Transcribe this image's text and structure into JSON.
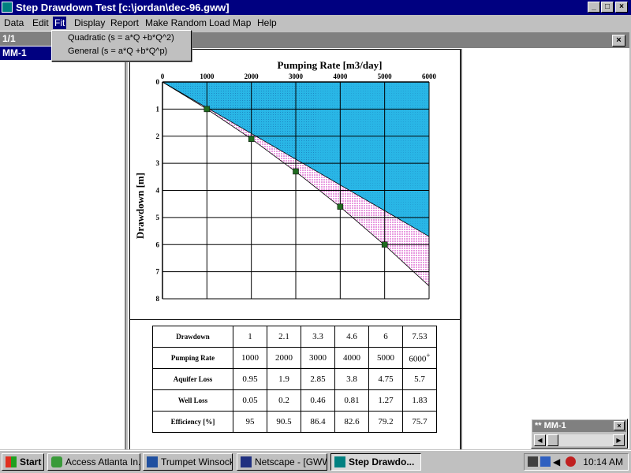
{
  "window": {
    "title": "Step Drawdown Test [c:\\jordan\\dec-96.gww]",
    "buttons": {
      "minimize": "_",
      "maximize": "□",
      "close": "×"
    }
  },
  "menu": {
    "items": [
      "Data",
      "Edit",
      "Fit",
      "Display",
      "Report",
      "Make Random",
      "Load Map",
      "Help"
    ],
    "active": "Fit"
  },
  "fit_dropdown": {
    "items": [
      "Quadratic  (s = a*Q +b*Q^2)",
      "General  (s = a*Q +b*Q^p)"
    ]
  },
  "left_panel": {
    "header": "1/1",
    "selected_item": "MM-1"
  },
  "chart_data": {
    "type": "line",
    "title": "Pumping Rate [m3/day]",
    "xlabel": "Pumping Rate [m3/day]",
    "ylabel": "Drawdown [m]",
    "x_axis_position": "top",
    "y_inverted": true,
    "xlim": [
      0,
      6000
    ],
    "ylim": [
      0,
      8
    ],
    "x_ticks": [
      "0",
      "1000",
      "2000",
      "3000",
      "4000",
      "5000",
      "6000"
    ],
    "y_ticks": [
      "0",
      "1",
      "2",
      "3",
      "4",
      "5",
      "6",
      "7",
      "8"
    ],
    "grid": true,
    "observed_points": {
      "x": [
        1000,
        2000,
        3000,
        4000,
        5000
      ],
      "y": [
        1,
        2.1,
        3.3,
        4.6,
        6
      ]
    },
    "aquifer_loss_line": {
      "x": [
        0,
        6000
      ],
      "y": [
        0,
        5.7
      ]
    },
    "total_drawdown_curve": {
      "x": [
        0,
        1000,
        2000,
        3000,
        4000,
        5000,
        6000
      ],
      "y": [
        0,
        1,
        2.1,
        3.31,
        4.61,
        6.02,
        7.53
      ]
    },
    "colors": {
      "upper_region": "#29b6e6",
      "well_loss_region": "#e89be0",
      "points": "#1f6b1f",
      "grid": "#000000"
    }
  },
  "table": {
    "rows": [
      {
        "label": "Drawdown",
        "values": [
          "1",
          "2.1",
          "3.3",
          "4.6",
          "6",
          "7.53"
        ]
      },
      {
        "label": "Pumping Rate",
        "values": [
          "1000",
          "2000",
          "3000",
          "4000",
          "5000",
          "6000+"
        ]
      },
      {
        "label": "Aquifer Loss",
        "values": [
          "0.95",
          "1.9",
          "2.85",
          "3.8",
          "4.75",
          "5.7"
        ]
      },
      {
        "label": "Well Loss",
        "values": [
          "0.05",
          "0.2",
          "0.46",
          "0.81",
          "1.27",
          "1.83"
        ]
      },
      {
        "label": "Efficiency [%]",
        "values": [
          "95",
          "90.5",
          "86.4",
          "82.6",
          "79.2",
          "75.7"
        ]
      }
    ]
  },
  "mini_window": {
    "title": "** MM-1"
  },
  "taskbar": {
    "start": "Start",
    "buttons": [
      "Access Atlanta In...",
      "Trumpet Winsock",
      "Netscape - [GWW]",
      "Step Drawdo..."
    ],
    "active": "Step Drawdo...",
    "clock": "10:14 AM"
  }
}
